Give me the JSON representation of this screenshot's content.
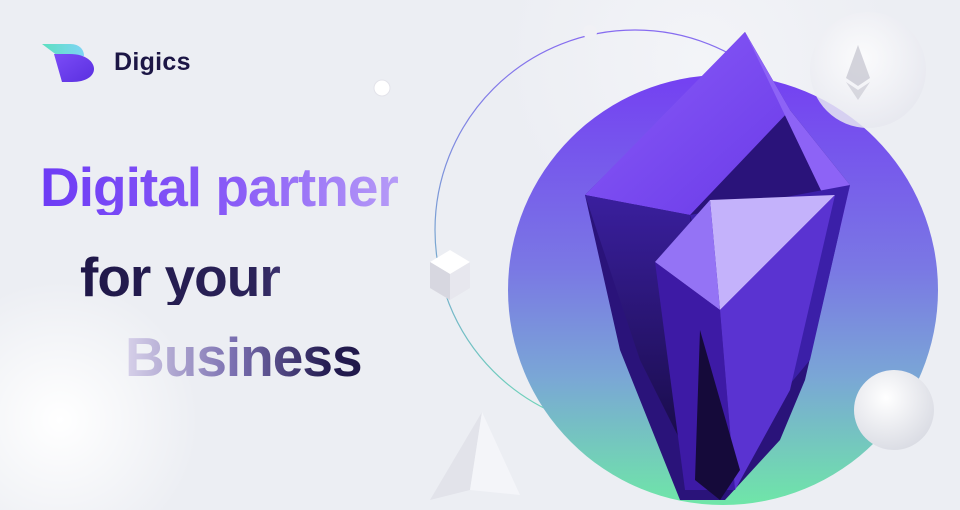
{
  "brand": {
    "name": "Digics",
    "logo_icon": "digics-logo-icon"
  },
  "hero": {
    "line1": "Digital partner",
    "line2": "for your",
    "line3": "Business"
  },
  "decorations": [
    "orbit-ring",
    "gradient-circle",
    "crystal-illustration",
    "glass-sphere",
    "polyhedron-icon",
    "pyramid-icon",
    "ethereum-icon"
  ],
  "colors": {
    "brand_purple": "#6d3bf5",
    "brand_dark": "#1c1645",
    "circle_top": "#7440f2",
    "circle_bottom": "#6fe6a8"
  }
}
